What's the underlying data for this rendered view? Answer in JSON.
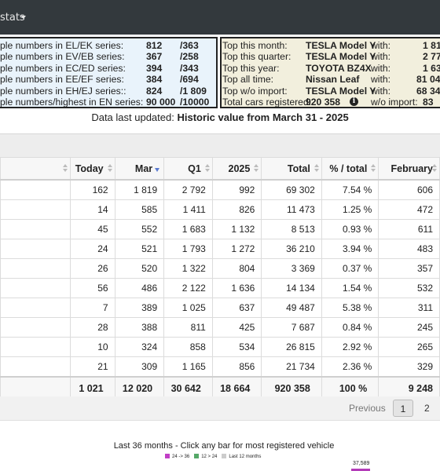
{
  "nav": {
    "menu_label": "stats"
  },
  "left_panel": [
    {
      "label": "ple numbers in EL/EK series:",
      "value": "812",
      "of": "/363"
    },
    {
      "label": "ple numbers in EV/EB series:",
      "value": "367",
      "of": "/258"
    },
    {
      "label": "ple numbers in EC/ED series:",
      "value": "394",
      "of": "/343"
    },
    {
      "label": "ple numbers in EE/EF series:",
      "value": "384",
      "of": "/694"
    },
    {
      "label": "ple numbers in EH/EJ series::",
      "value": "824",
      "of": "/1 809"
    },
    {
      "label": "ple numbers/highest in EN series:",
      "value": "90 000",
      "of": "/10000"
    }
  ],
  "right_panel": [
    {
      "label": "Top this month:",
      "value": "TESLA Model Y",
      "with": "with:",
      "count": "1 81"
    },
    {
      "label": "Top this quarter:",
      "value": "TESLA Model Y",
      "with": "with:",
      "count": "2 77"
    },
    {
      "label": "Top this year:",
      "value": "TOYOTA BZ4X",
      "with": "with:",
      "count": "1 63"
    },
    {
      "label": "Top all time:",
      "value": "Nissan Leaf",
      "with": "with:",
      "count": "81 04"
    },
    {
      "label": "Top w/o import:",
      "value": "TESLA Model Y",
      "with": "with:",
      "count": "68 34"
    },
    {
      "label": "Total cars registered:",
      "value": "920 358",
      "with": "w/o import:",
      "count": "83"
    }
  ],
  "updated": {
    "prefix": "Data last updated: ",
    "value": "Historic value from March 31 - 2025"
  },
  "table": {
    "headers": [
      "Today",
      "Mar",
      "Q1",
      "2025",
      "Total",
      "% / total",
      "February"
    ],
    "rows": [
      [
        "162",
        "1 819",
        "2 792",
        "992",
        "69 302",
        "7.54 %",
        "606"
      ],
      [
        "14",
        "585",
        "1 411",
        "826",
        "11 473",
        "1.25 %",
        "472"
      ],
      [
        "45",
        "552",
        "1 683",
        "1 132",
        "8 513",
        "0.93 %",
        "611"
      ],
      [
        "24",
        "521",
        "1 793",
        "1 272",
        "36 210",
        "3.94 %",
        "483"
      ],
      [
        "26",
        "520",
        "1 322",
        "804",
        "3 369",
        "0.37 %",
        "357"
      ],
      [
        "56",
        "486",
        "2 122",
        "1 636",
        "14 134",
        "1.54 %",
        "532"
      ],
      [
        "7",
        "389",
        "1 025",
        "637",
        "49 487",
        "5.38 %",
        "311"
      ],
      [
        "28",
        "388",
        "811",
        "425",
        "7 687",
        "0.84 %",
        "245"
      ],
      [
        "10",
        "324",
        "858",
        "534",
        "26 815",
        "2.92 %",
        "265"
      ],
      [
        "21",
        "309",
        "1 165",
        "856",
        "21 734",
        "2.36 %",
        "329"
      ]
    ],
    "totals": [
      "1 021",
      "12 020",
      "30 642",
      "18 664",
      "920 358",
      "100 %",
      "9 248"
    ]
  },
  "pager": {
    "previous": "Previous",
    "page1": "1",
    "page2": "2"
  },
  "chart": {
    "title": "Last 36 months - Click any bar for most registered vehicle",
    "legend": [
      {
        "label": "24 -> 36",
        "color": "#c13fc6"
      },
      {
        "label": "12 > 24",
        "color": "#55a868"
      },
      {
        "label": "Last 12 months",
        "color": "#cccccc"
      }
    ],
    "top_bar_value": "37,589",
    "bar_color": "#b33bb8"
  }
}
